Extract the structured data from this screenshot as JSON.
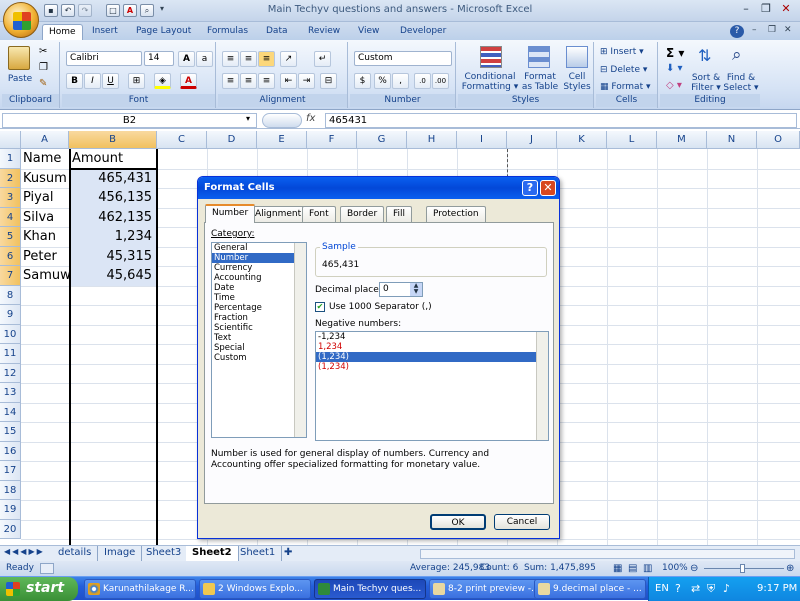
{
  "window": {
    "title": "Main Techyv questions and answers - Microsoft Excel"
  },
  "ribbon_tabs": [
    "Home",
    "Insert",
    "Page Layout",
    "Formulas",
    "Data",
    "Review",
    "View",
    "Developer"
  ],
  "ribbon": {
    "paste": "Paste",
    "font_name": "Calibri",
    "font_size": "14",
    "number_format": "Custom",
    "conditional_formatting": [
      "Conditional",
      "Formatting ▾"
    ],
    "format_as_table": [
      "Format",
      "as Table ▾"
    ],
    "cell_styles": [
      "Cell",
      "Styles ▾"
    ],
    "insert": "Insert ▾",
    "delete": "Delete ▾",
    "format": "Format ▾",
    "sort_filter": [
      "Sort &",
      "Filter ▾"
    ],
    "find_select": [
      "Find &",
      "Select ▾"
    ],
    "group_labels": [
      "Clipboard",
      "Font",
      "Alignment",
      "Number",
      "Styles",
      "Cells",
      "Editing"
    ]
  },
  "formula_bar": {
    "name_box": "B2",
    "fx": "fx",
    "value": "465431"
  },
  "grid": {
    "columns": [
      "A",
      "B",
      "C",
      "D",
      "E",
      "F",
      "G",
      "H",
      "I",
      "J",
      "K",
      "L",
      "M",
      "N",
      "O"
    ],
    "rows": [
      "1",
      "2",
      "3",
      "4",
      "5",
      "6",
      "7",
      "8",
      "9",
      "10",
      "11",
      "12",
      "13",
      "14",
      "15",
      "16",
      "17",
      "18",
      "19",
      "20"
    ],
    "cells": [
      [
        "Name",
        "Amount"
      ],
      [
        "Kusum",
        "465,431"
      ],
      [
        "Piyal",
        "456,135"
      ],
      [
        "Silva",
        "462,135"
      ],
      [
        "Khan",
        "1,234"
      ],
      [
        "Peter",
        "45,315"
      ],
      [
        "Samuwe",
        "45,645"
      ]
    ]
  },
  "sheet_tabs": [
    "details",
    "Image",
    "Sheet3",
    "Sheet2",
    "Sheet1"
  ],
  "active_sheet": "Sheet2",
  "status": {
    "ready": "Ready",
    "average": "Average: 245,983",
    "count": "Count: 6",
    "sum": "Sum: 1,475,895",
    "zoom": "100%"
  },
  "dialog": {
    "title": "Format Cells",
    "tabs": [
      "Number",
      "Alignment",
      "Font",
      "Border",
      "Fill",
      "Protection"
    ],
    "category_label": "Category:",
    "categories": [
      "General",
      "Number",
      "Currency",
      "Accounting",
      "Date",
      "Time",
      "Percentage",
      "Fraction",
      "Scientific",
      "Text",
      "Special",
      "Custom"
    ],
    "selected_category": "Number",
    "sample_label": "Sample",
    "sample_value": "465,431",
    "decimal_places_label": "Decimal places:",
    "decimal_places": "0",
    "separator_label": "Use 1000 Separator (,)",
    "negative_label": "Negative numbers:",
    "negative_options": [
      "-1,234",
      "1,234",
      "(1,234)",
      "(1,234)"
    ],
    "description": "Number is used for general display of numbers.  Currency and Accounting offer specialized formatting for monetary value.",
    "ok": "OK",
    "cancel": "Cancel"
  },
  "taskbar": {
    "start": "start",
    "tasks": [
      "Karunathilakage R...",
      "2 Windows Explo...",
      "Main Techyv ques...",
      "8-2 print preview -...",
      "9.decimal place - ..."
    ],
    "lang": "EN",
    "clock": "9:17 PM"
  }
}
